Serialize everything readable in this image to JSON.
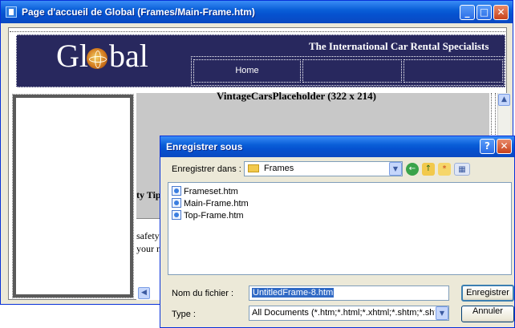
{
  "main_window": {
    "title": "Page d'accueil de Global (Frames/Main-Frame.htm)",
    "controls": {
      "minimize": "_",
      "maximize": "□",
      "close": "✕"
    }
  },
  "banner": {
    "logo_prefix": "Gl",
    "logo_suffix": "bal",
    "tagline": "The International Car Rental Specialists",
    "nav_home": "Home"
  },
  "content": {
    "placeholder": "VintageCarsPlaceholder (322 x 214)",
    "tips_heading": "ty Tip",
    "safety_line1": "safety",
    "safety_line2": "your n",
    "scroll_up": "▲",
    "scroll_left": "◀"
  },
  "dialog": {
    "title": "Enregistrer sous",
    "help": "?",
    "close": "✕",
    "save_in_label": "Enregistrer dans :",
    "save_in_value": "Frames",
    "files": [
      "Frameset.htm",
      "Main-Frame.htm",
      "Top-Frame.htm"
    ],
    "filename_label": "Nom du fichier :",
    "filename_value": "UntitledFrame-8.htm",
    "type_label": "Type :",
    "type_value": "All Documents (*.htm;*.html;*.xhtml;*.shtm;*.shtml;*.stm;*",
    "save_button": "Enregistrer",
    "cancel_button": "Annuler",
    "dropdown_arrow": "▼"
  },
  "colors": {
    "titlebar": "#0552d0",
    "banner_background": "#28285e",
    "selection": "#316ac5"
  }
}
